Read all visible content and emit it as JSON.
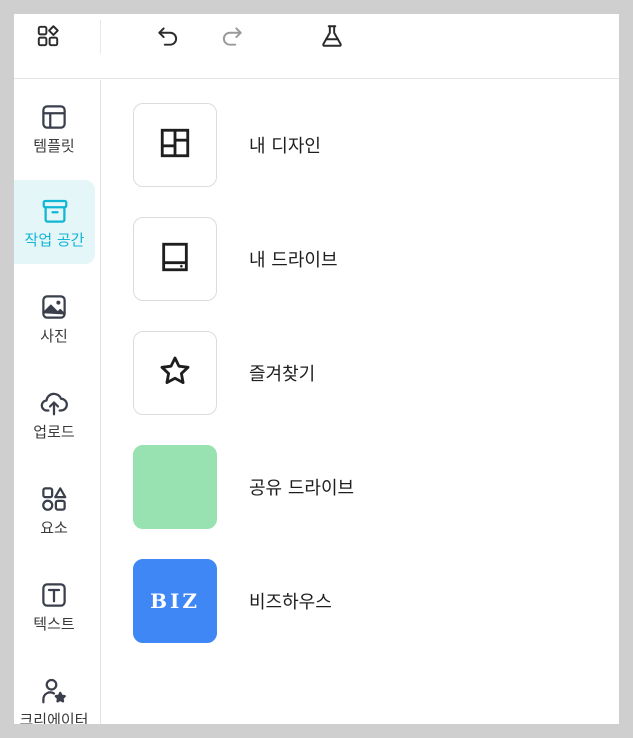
{
  "toolbar": {
    "apps_icon": "apps-icon",
    "undo_icon": "undo-icon",
    "redo_icon": "redo-icon",
    "flask_icon": "flask-icon"
  },
  "sidebar": {
    "items": [
      {
        "label": "템플릿",
        "icon": "template-icon",
        "active": false
      },
      {
        "label": "작업 공간",
        "icon": "archive-icon",
        "active": true
      },
      {
        "label": "사진",
        "icon": "photo-icon",
        "active": false
      },
      {
        "label": "업로드",
        "icon": "cloud-upload-icon",
        "active": false
      },
      {
        "label": "요소",
        "icon": "shapes-icon",
        "active": false
      },
      {
        "label": "텍스트",
        "icon": "text-icon",
        "active": false
      },
      {
        "label": "크리에이터",
        "icon": "creator-icon",
        "active": false
      }
    ]
  },
  "workspace": {
    "items": [
      {
        "title": "내 디자인",
        "icon": "layout-grid-icon"
      },
      {
        "title": "내 드라이브",
        "icon": "drive-icon"
      },
      {
        "title": "즐겨찾기",
        "icon": "star-icon"
      },
      {
        "title": "공유 드라이브",
        "thumb_color": "#97e2b0"
      },
      {
        "title": "비즈하우스",
        "thumb_color": "#3f87f5",
        "thumb_text": "BIZ"
      }
    ]
  },
  "colors": {
    "accent": "#10b6d4",
    "active_bg": "#e5f6f9",
    "shared_drive": "#97e2b0",
    "bizhouse": "#3f87f5"
  }
}
